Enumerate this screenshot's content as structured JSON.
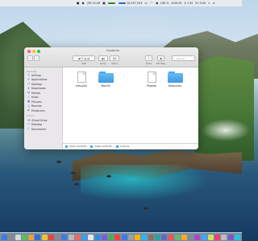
{
  "menubar": {
    "clock": "5:14:49",
    "network_up": "10,537,033",
    "battery": "100 %",
    "time_zone": "6:09:49",
    "rates": "$ 7.42",
    "date": "Fri 3:09"
  },
  "window": {
    "title": "Contents",
    "toolbar": {
      "back": "‹",
      "forward": "›",
      "view_label": "View",
      "group_label": "Group",
      "action_label": "Action",
      "share_label": "Share",
      "edit_tags_label": "Edit Tags",
      "search_placeholder": "Search"
    },
    "sidebar": {
      "favorites_header": "Favorites",
      "favorites": [
        {
          "label": "AirDrop",
          "icon": "airdrop-icon"
        },
        {
          "label": "Applications",
          "icon": "applications-icon"
        },
        {
          "label": "Desktop",
          "icon": "desktop-icon"
        },
        {
          "label": "Downloads",
          "icon": "downloads-icon"
        },
        {
          "label": "Movies",
          "icon": "movies-icon"
        },
        {
          "label": "Music",
          "icon": "music-icon"
        },
        {
          "label": "Pictures",
          "icon": "pictures-icon"
        },
        {
          "label": "Recents",
          "icon": "recents-icon"
        },
        {
          "label": "Emoticons",
          "icon": "folder-icon"
        }
      ],
      "icloud_header": "iCloud",
      "icloud": [
        {
          "label": "iCloud Drive",
          "icon": "cloud-icon"
        },
        {
          "label": "Desktop",
          "icon": "desktop-icon"
        },
        {
          "label": "Documents",
          "icon": "documents-icon"
        }
      ]
    },
    "files": [
      {
        "name": "Info.plist",
        "kind": "document"
      },
      {
        "name": "MacOS",
        "kind": "folder"
      },
      {
        "name": "PkgInfo",
        "kind": "document"
      },
      {
        "name": "Resources",
        "kind": "folder"
      }
    ],
    "path": [
      "Install macOS Bi…",
      "Install macOS Bi…",
      "Contents"
    ]
  },
  "colors": {
    "folder_blue": "#4ca6ea",
    "sidebar_bg": "#e9e7ea",
    "accent": "#3b7fdb"
  },
  "dock": {
    "icon_colors": [
      "#3c7be0",
      "#8a8a8a",
      "#d9d9d9",
      "#5bbd5b",
      "#e9a23b",
      "#2f6fd8",
      "#f2c12e",
      "#e5473c",
      "#8a8a8a",
      "#3c7be0",
      "#b9b9b9",
      "#ed6a5e",
      "#3aa0f0",
      "#e7e7e7",
      "#2d8ee0",
      "#7a5cd6",
      "#4caf50",
      "#f44336",
      "#3c7be0",
      "#9e9e9e",
      "#ffb300",
      "#29b6f6",
      "#8d6e63",
      "#26a69a",
      "#5c6bc0",
      "#ef5350",
      "#66bb6a",
      "#ffa726",
      "#78909c",
      "#ab47bc",
      "#42a5f5",
      "#d4e157",
      "#ec407a",
      "#bdbdbd",
      "#7e57c2",
      "#26c6da"
    ]
  }
}
